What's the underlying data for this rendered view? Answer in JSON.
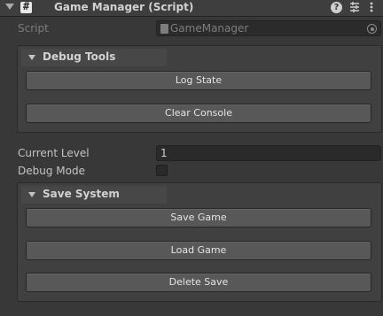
{
  "component": {
    "title": "Game Manager (Script)",
    "script_glyph": "#",
    "header_icons": [
      "chevron-down-icon",
      "help-icon",
      "presets-icon",
      "context-menu-icon"
    ],
    "help_glyph": "?"
  },
  "script_row": {
    "label": "Script",
    "value": "GameManager"
  },
  "debug_tools": {
    "title": "Debug Tools",
    "buttons": [
      "Log State",
      "Clear Console"
    ]
  },
  "properties": {
    "current_level": {
      "label": "Current Level",
      "value": "1"
    },
    "debug_mode": {
      "label": "Debug Mode",
      "checked": false
    }
  },
  "save_system": {
    "title": "Save System",
    "buttons": [
      "Save Game",
      "Load Game",
      "Delete Save"
    ]
  },
  "colors": {
    "background": "#383838",
    "button": "#585858",
    "field": "#2a2a2a",
    "text": "#c4c4c4"
  }
}
